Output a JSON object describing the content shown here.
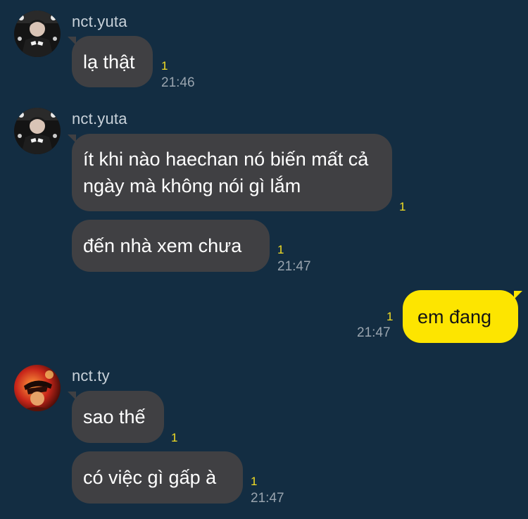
{
  "chat": {
    "groups": [
      {
        "sender": "nct.yuta",
        "avatar_icon": "yuta-profile-photo",
        "messages": [
          {
            "text": "lạ thật",
            "read_count": "1",
            "time": "21:46"
          }
        ]
      },
      {
        "sender": "nct.yuta",
        "avatar_icon": "yuta-profile-photo",
        "messages": [
          {
            "text": "ít khi nào haechan nó biến mất cả ngày mà không nói gì lắm",
            "read_count": "1"
          },
          {
            "text": "đến nhà xem chưa",
            "read_count": "1",
            "time": "21:47"
          }
        ]
      },
      {
        "sender": "me",
        "messages": [
          {
            "text": "em đang",
            "read_count": "1",
            "time": "21:47"
          }
        ]
      },
      {
        "sender": "nct.ty",
        "avatar_icon": "ty-profile-photo",
        "messages": [
          {
            "text": "sao thế",
            "read_count": "1"
          },
          {
            "text": "có việc gì gấp à",
            "read_count": "1",
            "time": "21:47"
          }
        ]
      }
    ]
  },
  "colors": {
    "background": "#132d42",
    "incoming_bubble": "#404043",
    "outgoing_bubble": "#fde500",
    "read_count": "#f2dd24",
    "timestamp": "#99a4ae"
  }
}
